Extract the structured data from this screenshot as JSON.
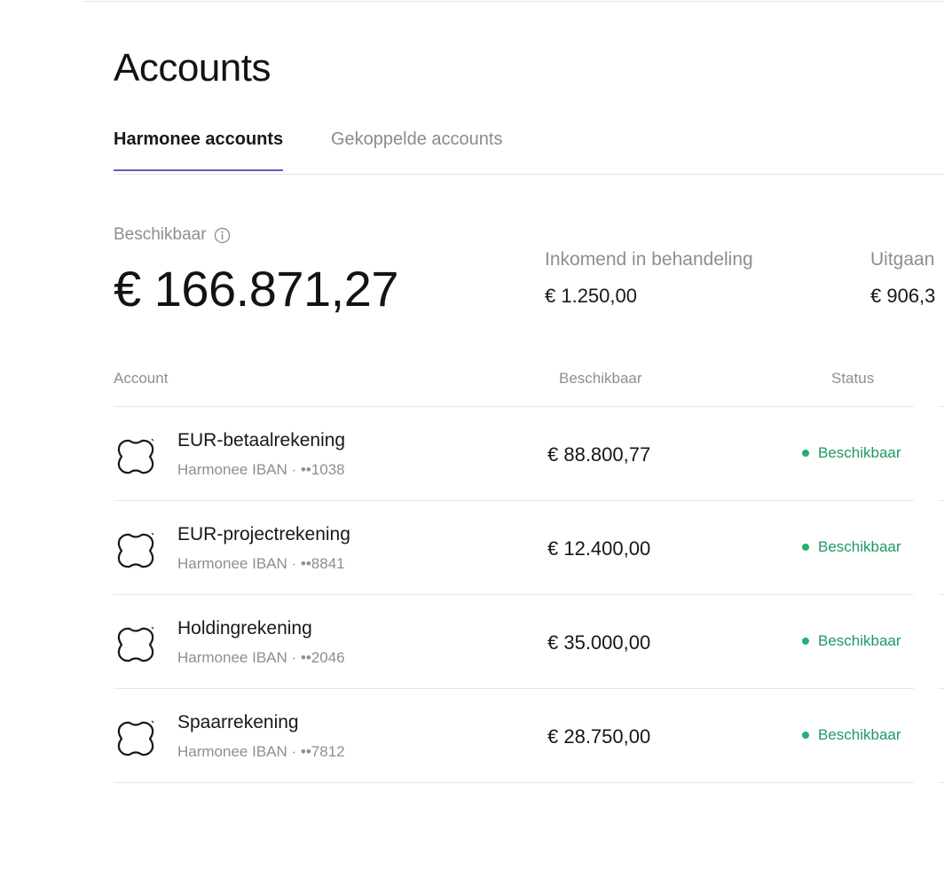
{
  "page": {
    "title": "Accounts"
  },
  "tabs": [
    {
      "label": "Harmonee accounts",
      "active": true
    },
    {
      "label": "Gekoppelde accounts",
      "active": false
    }
  ],
  "summary": {
    "available_label": "Beschikbaar",
    "available_amount": "€ 166.871,27",
    "incoming_label": "Inkomend in behandeling",
    "incoming_amount": "€ 1.250,00",
    "outgoing_label": "Uitgaan",
    "outgoing_amount": "€ 906,3"
  },
  "table": {
    "headers": [
      "Account",
      "Beschikbaar",
      "Status"
    ],
    "rows": [
      {
        "name": "EUR-betaalrekening",
        "sub": "Harmonee IBAN · ••1038",
        "balance": "€ 88.800,77",
        "status": "Beschikbaar"
      },
      {
        "name": "EUR-projectrekening",
        "sub": "Harmonee IBAN · ••8841",
        "balance": "€ 12.400,00",
        "status": "Beschikbaar"
      },
      {
        "name": "Holdingrekening",
        "sub": "Harmonee IBAN · ••2046",
        "balance": "€ 35.000,00",
        "status": "Beschikbaar"
      },
      {
        "name": "Spaarrekening",
        "sub": "Harmonee IBAN · ••7812",
        "balance": "€ 28.750,00",
        "status": "Beschikbaar"
      }
    ]
  },
  "colors": {
    "tab_underline": "#5b5fc7",
    "status_green": "#1e9a62",
    "status_dot": "#24b070"
  },
  "icons": {
    "account": "harmonee-logo-icon",
    "info": "info-icon",
    "status": "status-dot-icon"
  }
}
